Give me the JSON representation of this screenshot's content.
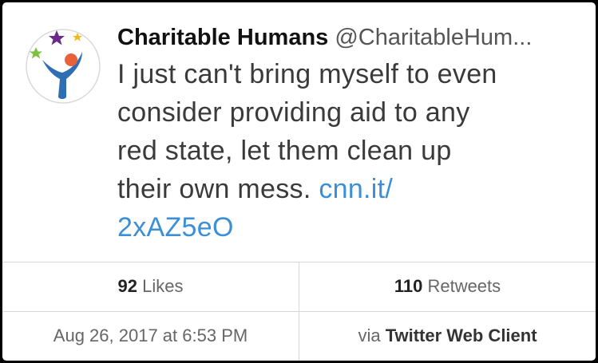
{
  "account": {
    "display_name": "Charitable Humans",
    "handle": "@CharitableHum..."
  },
  "tweet": {
    "text_parts": [
      "I just can't bring myself to even",
      "consider providing aid to any",
      "red state, let them clean up",
      "their own mess. "
    ],
    "link_part1": "cnn.it/",
    "link_part2": "2xAZ5eO"
  },
  "stats": {
    "likes_count": "92",
    "likes_label": "Likes",
    "retweets_count": "110",
    "retweets_label": "Retweets"
  },
  "meta": {
    "timestamp": "Aug 26, 2017 at 6:53 PM",
    "via_label": "via",
    "client": "Twitter Web Client"
  },
  "colors": {
    "link": "#3b8fd6",
    "avatar_figure": "#2f6db5",
    "avatar_head": "#e8613a"
  }
}
